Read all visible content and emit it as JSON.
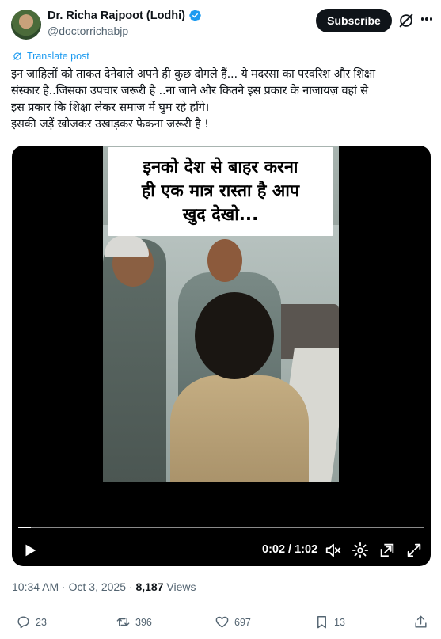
{
  "author": {
    "display_name": "Dr. Richa Rajpoot (Lodhi)",
    "handle": "@doctorrichabjp"
  },
  "header": {
    "subscribe_label": "Subscribe"
  },
  "translate_label": "Translate post",
  "post_lines": [
    "इन जाहिलों को ताकत देनेवाले अपने ही कुछ दोगले हैं... ये मदरसा का परवरिश और शिक्षा",
    "संस्कार है..जिसका उपचार जरूरी है ..ना जाने और कितने इस प्रकार के नाजायज़ वहां से",
    "इस प्रकार कि शिक्षा लेकर समाज में घुम रहे होंगे।",
    "इसकी जड़ें खोजकर उखाड़कर फेकना जरूरी है !"
  ],
  "video": {
    "caption_lines": [
      "इनको देश से बाहर करना",
      "ही एक मात्र रास्ता है आप",
      "खुद देखो..."
    ],
    "time_display": "0:02 / 1:02",
    "progress_fraction": 0.032
  },
  "meta": {
    "time": "10:34 AM",
    "separator": " · ",
    "date": "Oct 3, 2025",
    "views_count": "8,187",
    "views_label": " Views"
  },
  "actions": {
    "replies": "23",
    "reposts": "396",
    "likes": "697",
    "bookmarks": "13"
  },
  "colors": {
    "accent": "#1d9bf0",
    "text": "#0f1419",
    "secondary": "#536471"
  }
}
